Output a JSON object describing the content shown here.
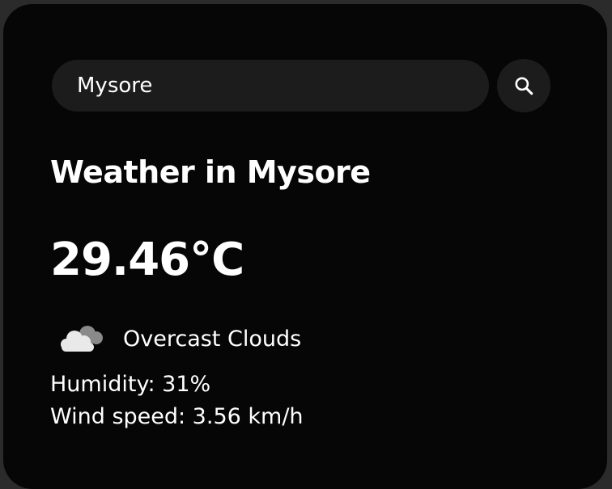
{
  "search": {
    "value": "Mysore",
    "button_icon": "search-icon"
  },
  "weather": {
    "title": "Weather in Mysore",
    "temperature": "29.46°C",
    "condition_icon": "cloud-icon",
    "condition": "Overcast Clouds",
    "humidity": "Humidity: 31%",
    "wind": "Wind speed: 3.56 km/h"
  },
  "colors": {
    "background": "#060606",
    "surface": "#1c1c1c",
    "text": "#ffffff"
  }
}
